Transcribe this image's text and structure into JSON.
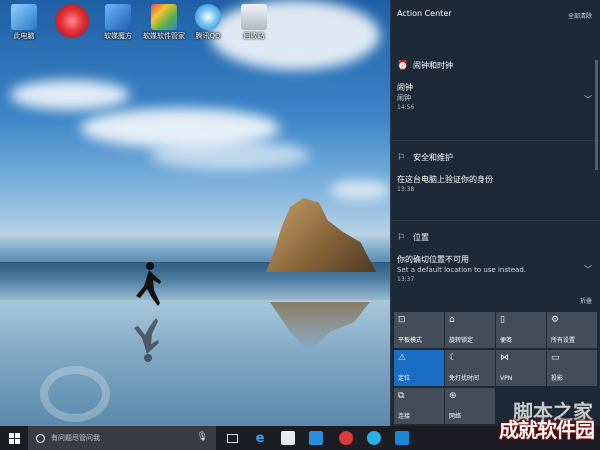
{
  "desktop": {
    "icons": [
      {
        "label": "此电脑",
        "icon": "computer-icon",
        "color": "#3a8fd8"
      },
      {
        "label": "",
        "icon": "red-disc-icon",
        "color": "#e2323a"
      },
      {
        "label": "软媒魔方",
        "icon": "cube-app-icon",
        "color": "#2a6fbf"
      },
      {
        "label": "软媒软件管家",
        "icon": "software-manager-icon",
        "color": "#5bb04a"
      },
      {
        "label": "腾讯QQ",
        "icon": "qq-icon",
        "color": "#2b9fe6"
      },
      {
        "label": "回收站",
        "icon": "recycle-bin-icon",
        "color": "#cfd8df"
      }
    ]
  },
  "action_center": {
    "title": "Action Center",
    "clear_all": "全部清除",
    "groups": [
      {
        "header": "闹钟和时钟",
        "icon": "alarm-clock-icon",
        "title": "闹钟",
        "body": "闹钟",
        "time": "14:56"
      },
      {
        "header": "安全和维护",
        "icon": "security-flag-icon",
        "title": "在这台电脑上验证你的身份",
        "body": "",
        "time": "13:38"
      },
      {
        "header": "位置",
        "icon": "location-flag-icon",
        "title": "你的确切位置不可用",
        "body": "Set a default location to use instead.",
        "time": "13:37"
      }
    ],
    "collapse_label": "折叠",
    "tiles": [
      {
        "label": "平板模式",
        "icon": "tablet-mode-icon",
        "active": false
      },
      {
        "label": "旋转锁定",
        "icon": "rotation-lock-icon",
        "active": false
      },
      {
        "label": "便笺",
        "icon": "note-icon",
        "active": false
      },
      {
        "label": "所有设置",
        "icon": "gear-icon",
        "active": false
      },
      {
        "label": "定位",
        "icon": "location-icon",
        "active": true
      },
      {
        "label": "免打扰时间",
        "icon": "moon-icon",
        "active": false
      },
      {
        "label": "VPN",
        "icon": "vpn-icon",
        "active": false
      },
      {
        "label": "投影",
        "icon": "project-icon",
        "active": false
      },
      {
        "label": "连接",
        "icon": "connect-icon",
        "active": false
      },
      {
        "label": "网络",
        "icon": "network-icon",
        "active": false
      }
    ]
  },
  "taskbar": {
    "search_placeholder": "有问题尽管问我",
    "apps": [
      {
        "icon": "task-view-icon"
      },
      {
        "icon": "edge-icon"
      },
      {
        "icon": "store-icon"
      },
      {
        "icon": "mail-icon"
      },
      {
        "icon": "music-app-icon"
      },
      {
        "icon": "browser-icon"
      },
      {
        "icon": "active-app-icon"
      }
    ]
  },
  "watermark": {
    "text": "成就软件园"
  },
  "overlay": {
    "text": "脚本之家"
  }
}
